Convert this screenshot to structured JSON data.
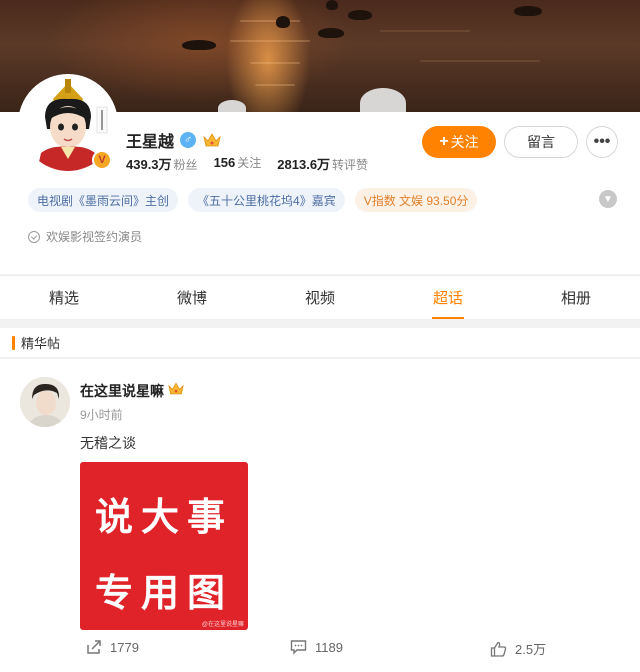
{
  "profile": {
    "name": "王星越",
    "verified_badge": "V",
    "followers_count": "439.3万",
    "followers_label": "粉丝",
    "following_count": "156",
    "following_label": "关注",
    "reposts_comments_likes_count": "2813.6万",
    "reposts_comments_likes_label": "转评赞",
    "follow_button": "关注",
    "message_button": "留言",
    "more_button": "•••",
    "tags": [
      {
        "label": "电视剧《墨雨云间》主创"
      },
      {
        "label": "《五十公里桃花坞4》嘉宾"
      },
      {
        "label": "V指数 文娱 93.50分"
      }
    ],
    "signing": "欢娱影视签约演员"
  },
  "tabs": [
    {
      "label": "精选"
    },
    {
      "label": "微博"
    },
    {
      "label": "视频"
    },
    {
      "label": "超话"
    },
    {
      "label": "相册"
    }
  ],
  "active_tab": "超话",
  "section": {
    "title": "精华帖"
  },
  "post": {
    "author": "在这里说星嘛",
    "time": "9小时前",
    "text": "无稽之谈",
    "image_line1": "说大事",
    "image_line2": "专用图",
    "image_watermark": "@在这里说星嘛",
    "reposts": "1779",
    "comments": "1189",
    "likes": "2.5万"
  },
  "colors": {
    "accent": "#ff8200",
    "tag_bg": "#eef3fa",
    "tag_text": "#4e6ea3",
    "vindex_text": "#e2812b",
    "post_image_bg": "#e02229"
  },
  "icons": [
    "gender-male-icon",
    "crown-icon",
    "expand-chevron-icon",
    "sign-check-icon",
    "share-icon",
    "comment-icon",
    "like-icon",
    "more-icon"
  ]
}
